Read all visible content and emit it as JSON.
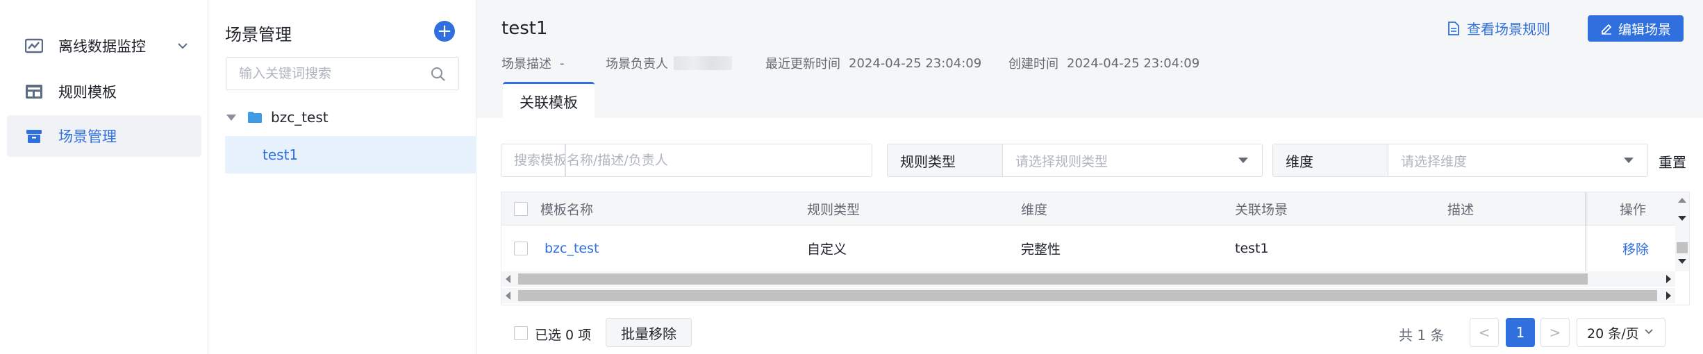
{
  "sidebar": {
    "items": [
      {
        "label": "离线数据监控",
        "icon": "monitor-chart-icon",
        "expandable": true
      },
      {
        "label": "规则模板",
        "icon": "template-icon"
      },
      {
        "label": "场景管理",
        "icon": "scene-box-icon",
        "active": true
      }
    ]
  },
  "tree": {
    "title": "场景管理",
    "add_label": "+",
    "search_placeholder": "输入关键词搜索",
    "parent": {
      "label": "bzc_test"
    },
    "child": {
      "label": "test1"
    }
  },
  "header": {
    "title": "test1",
    "meta": {
      "desc_label": "场景描述",
      "desc_value": "-",
      "owner_label": "场景负责人",
      "updated_label": "最近更新时间",
      "updated_value": "2024-04-25 23:04:09",
      "created_label": "创建时间",
      "created_value": "2024-04-25 23:04:09"
    },
    "rules_link": "查看场景规则",
    "edit_button": "编辑场景"
  },
  "tabs": [
    {
      "label": "关联模板",
      "active": true
    }
  ],
  "filters": {
    "search_placeholder": "搜索模板名称/描述/负责人",
    "rule_type_label": "规则类型",
    "rule_type_placeholder": "请选择规则类型",
    "dimension_label": "维度",
    "dimension_placeholder": "请选择维度",
    "reset": "重置"
  },
  "table": {
    "columns": [
      "模板名称",
      "规则类型",
      "维度",
      "关联场景",
      "描述",
      "操作"
    ],
    "rows": [
      {
        "name": "bzc_test",
        "rule_type": "自定义",
        "dimension": "完整性",
        "scene": "test1",
        "desc": "",
        "action": "移除"
      }
    ]
  },
  "footer": {
    "selected": "已选 0 项",
    "batch_remove": "批量移除",
    "total": "共 1 条",
    "prev": "<",
    "current_page": "1",
    "next": ">",
    "page_size": "20 条/页"
  },
  "colors": {
    "accent": "#2f6fde",
    "header_bg": "#f5f6f8",
    "active_bg": "#e8f2fd"
  }
}
